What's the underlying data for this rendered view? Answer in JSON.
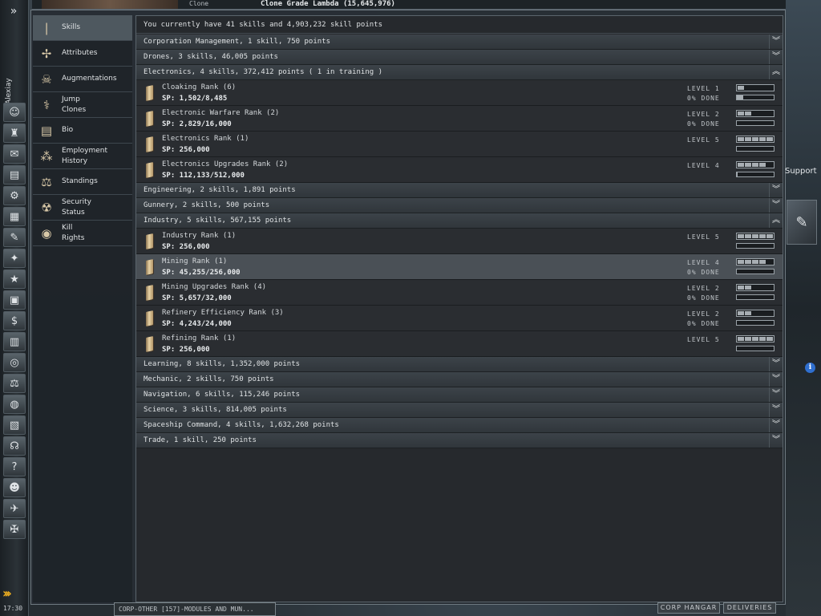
{
  "neocom": {
    "expand_glyph": "»",
    "character_name": "Alexiay",
    "clock": "17:30",
    "buttons": [
      {
        "name": "character-sheet-icon",
        "glyph": "☺"
      },
      {
        "name": "people-icon",
        "glyph": "♜"
      },
      {
        "name": "mail-icon",
        "glyph": "✉"
      },
      {
        "name": "notepad-icon",
        "glyph": "▤"
      },
      {
        "name": "fitting-icon",
        "glyph": "⚙"
      },
      {
        "name": "market-icon",
        "glyph": "▦"
      },
      {
        "name": "journal-icon",
        "glyph": "✎"
      },
      {
        "name": "map-icon",
        "glyph": "✦"
      },
      {
        "name": "corporation-icon",
        "glyph": "★"
      },
      {
        "name": "assets-icon",
        "glyph": "▣"
      },
      {
        "name": "wallet-icon",
        "glyph": "$"
      },
      {
        "name": "calculator-icon",
        "glyph": "▥"
      },
      {
        "name": "help-lifebuoy-icon",
        "glyph": "◎"
      },
      {
        "name": "contracts-icon",
        "glyph": "⚖"
      },
      {
        "name": "browser-icon",
        "glyph": "◍"
      },
      {
        "name": "news-icon",
        "glyph": "▧"
      },
      {
        "name": "headset-icon",
        "glyph": "☊"
      },
      {
        "name": "help-icon",
        "glyph": "?"
      },
      {
        "name": "agent-icon",
        "glyph": "☻"
      },
      {
        "name": "ships-icon",
        "glyph": "✈"
      },
      {
        "name": "drones-icon",
        "glyph": "✠"
      }
    ],
    "chevrons": "›››"
  },
  "top": {
    "clone_label": "Clone",
    "clone_value": "Clone Grade Lambda (15,645,976)"
  },
  "nav": [
    {
      "label": "Skills",
      "icon": "book-icon",
      "glyph": "❘",
      "selected": true
    },
    {
      "label": "Attributes",
      "icon": "attributes-icon",
      "glyph": "✢"
    },
    {
      "label": "Augmentations",
      "icon": "augmentations-icon",
      "glyph": "☠"
    },
    {
      "label": "Jump\nClones",
      "icon": "jump-clones-icon",
      "glyph": "⚕"
    },
    {
      "label": "Bio",
      "icon": "bio-icon",
      "glyph": "▤"
    },
    {
      "label": "Employment\nHistory",
      "icon": "employment-history-icon",
      "glyph": "⁂"
    },
    {
      "label": "Standings",
      "icon": "standings-icon",
      "glyph": "⚖"
    },
    {
      "label": "Security\nStatus",
      "icon": "security-status-icon",
      "glyph": "☢"
    },
    {
      "label": "Kill\nRights",
      "icon": "kill-rights-icon",
      "glyph": "◉"
    }
  ],
  "summary": "You currently have 41 skills and 4,903,232 skill points",
  "rows": [
    {
      "kind": "group",
      "text": "Corporation Management, 1 skill, 750 points",
      "toggle": "︾"
    },
    {
      "kind": "group",
      "text": "Drones, 3 skills, 46,005 points",
      "toggle": "︾"
    },
    {
      "kind": "group",
      "text": "Electronics, 4 skills, 372,412 points ( 1 in training )",
      "toggle": "︽"
    },
    {
      "kind": "skill",
      "name": "Cloaking Rank (6)",
      "sp": "SP: 1,502/8,485",
      "level": "LEVEL 1",
      "done": "0% DONE",
      "level_value": 1,
      "progress_pct": 18
    },
    {
      "kind": "skill",
      "name": "Electronic Warfare Rank (2)",
      "sp": "SP: 2,829/16,000",
      "level": "LEVEL 2",
      "done": "0% DONE",
      "level_value": 2,
      "progress_pct": 0
    },
    {
      "kind": "skill",
      "name": "Electronics Rank (1)",
      "sp": "SP: 256,000",
      "level": "LEVEL 5",
      "done": "",
      "level_value": 5,
      "progress_pct": 0
    },
    {
      "kind": "skill",
      "name": "Electronics Upgrades Rank (2)",
      "sp": "SP: 112,133/512,000",
      "level": "LEVEL 4",
      "done": "",
      "level_value": 4,
      "progress_pct": 3
    },
    {
      "kind": "group",
      "text": "Engineering, 2 skills, 1,891 points",
      "toggle": "︾"
    },
    {
      "kind": "group",
      "text": "Gunnery, 2 skills, 500 points",
      "toggle": "︾"
    },
    {
      "kind": "group",
      "text": "Industry, 5 skills, 567,155 points",
      "toggle": "︽"
    },
    {
      "kind": "skill",
      "name": "Industry Rank (1)",
      "sp": "SP: 256,000",
      "level": "LEVEL 5",
      "done": "",
      "level_value": 5,
      "progress_pct": 0
    },
    {
      "kind": "skill",
      "name": "Mining Rank (1)",
      "sp": "SP: 45,255/256,000",
      "level": "LEVEL 4",
      "done": "0% DONE",
      "level_value": 4,
      "progress_pct": 0,
      "highlight": true
    },
    {
      "kind": "skill",
      "name": "Mining Upgrades Rank (4)",
      "sp": "SP: 5,657/32,000",
      "level": "LEVEL 2",
      "done": "0% DONE",
      "level_value": 2,
      "progress_pct": 0
    },
    {
      "kind": "skill",
      "name": "Refinery Efficiency Rank (3)",
      "sp": "SP: 4,243/24,000",
      "level": "LEVEL 2",
      "done": "0% DONE",
      "level_value": 2,
      "progress_pct": 0
    },
    {
      "kind": "skill",
      "name": "Refining Rank (1)",
      "sp": "SP: 256,000",
      "level": "LEVEL 5",
      "done": "",
      "level_value": 5,
      "progress_pct": 0
    },
    {
      "kind": "group",
      "text": "Learning, 8 skills, 1,352,000 points",
      "toggle": "︾"
    },
    {
      "kind": "group",
      "text": "Mechanic, 2 skills, 750 points",
      "toggle": "︾"
    },
    {
      "kind": "group",
      "text": "Navigation, 6 skills, 115,246 points",
      "toggle": "︾"
    },
    {
      "kind": "group",
      "text": "Science, 3 skills, 814,005 points",
      "toggle": "︾"
    },
    {
      "kind": "group",
      "text": "Spaceship Command, 4 skills, 1,632,268 points",
      "toggle": "︾"
    },
    {
      "kind": "group",
      "text": "Trade, 1 skill, 250 points",
      "toggle": "︾"
    }
  ],
  "right": {
    "support_text": "Support",
    "info_glyph": "i",
    "side_icon_glyph": "✎"
  },
  "bottom": {
    "tab_text": "CORP-OTHER [157]-MODULES AND MUN...",
    "buttons": [
      "CORP HANGAR",
      "DELIVERIES"
    ]
  },
  "colors": {
    "panel_bg": "#26292d",
    "group_bg": "#3c4349",
    "highlight_row": "#4a5056",
    "accent_chevron": "#f0b020",
    "info_blue": "#2f6fcf"
  }
}
